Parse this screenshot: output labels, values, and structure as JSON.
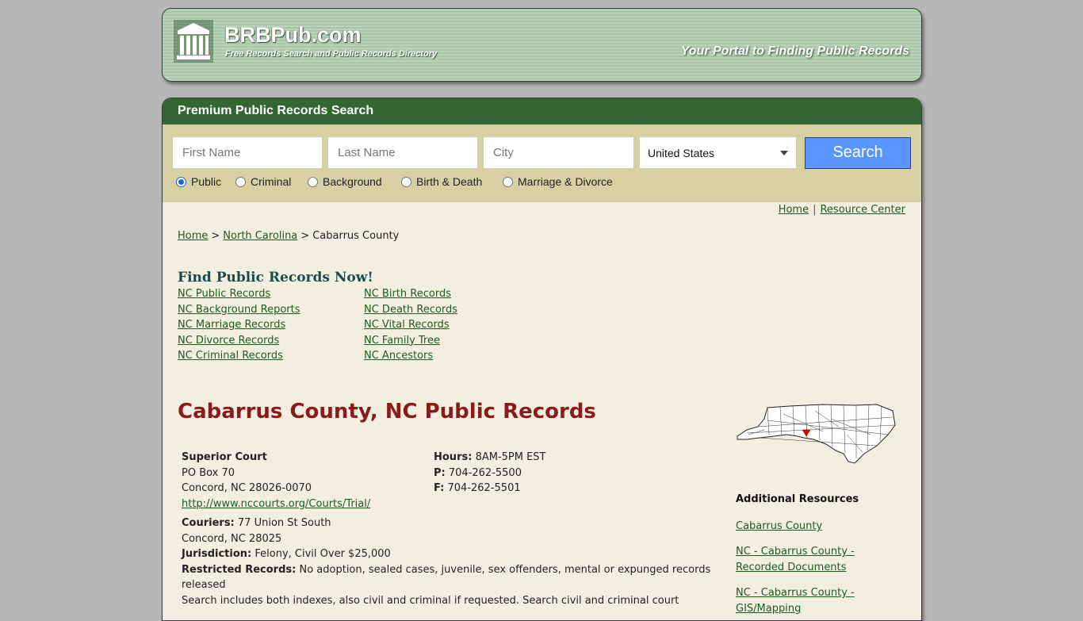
{
  "header": {
    "brand": "BRBPub.com",
    "subtitle": "Free Records Search and Public Records Directory",
    "tagline": "Your Portal to Finding Public Records"
  },
  "search": {
    "heading": "Premium Public Records Search",
    "first_name_placeholder": "First Name",
    "last_name_placeholder": "Last Name",
    "city_placeholder": "City",
    "country_selected": "United States",
    "button_label": "Search",
    "options": [
      {
        "label": "Public",
        "checked": true
      },
      {
        "label": "Criminal",
        "checked": false
      },
      {
        "label": "Background",
        "checked": false
      },
      {
        "label": "Birth & Death",
        "checked": false
      },
      {
        "label": "Marriage & Divorce",
        "checked": false
      }
    ]
  },
  "toplinks": {
    "home": "Home",
    "resource_center": "Resource Center"
  },
  "breadcrumb": {
    "home": "Home",
    "state": "North Carolina",
    "current": "Cabarrus County"
  },
  "find": {
    "title": "Find Public Records Now!",
    "col1": [
      "NC Public Records",
      "NC Background Reports",
      "NC Marriage Records",
      "NC Divorce Records",
      "NC Criminal Records"
    ],
    "col2": [
      "NC Birth Records",
      "NC Death Records",
      "NC Vital Records",
      "NC Family Tree",
      "NC Ancestors"
    ]
  },
  "page_title": "Cabarrus County, NC Public Records",
  "court": {
    "name": "Superior Court",
    "address1": "PO Box 70",
    "address2": "Concord, NC 28026-0070",
    "url": "http://www.nccourts.org/Courts/Trial/",
    "hours_label": "Hours:",
    "hours": "8AM-5PM EST",
    "phone_label": "P:",
    "phone": "704-262-5500",
    "fax_label": "F:",
    "fax": "704-262-5501",
    "couriers_label": "Couriers:",
    "couriers": "77 Union St South",
    "couriers_city": "Concord, NC 28025",
    "jurisdiction_label": "Jurisdiction:",
    "jurisdiction": "Felony, Civil Over $25,000",
    "restricted_label": "Restricted Records:",
    "restricted": "No adoption, sealed cases, juvenile, sex offenders, mental or expunged records released",
    "search_note": "Search includes both indexes, also civil and criminal if requested. Search civil and criminal court"
  },
  "sidebar": {
    "title": "Additional Resources",
    "links": [
      "Cabarrus County",
      "NC - Cabarrus County - Recorded Documents",
      "NC - Cabarrus County - GIS/Mapping"
    ]
  },
  "colors": {
    "header_green": "#336633",
    "search_bg": "#d8d0a2",
    "panel_bg": "#f3efe0",
    "title_red": "#8b1a1a",
    "button_blue": "#5a96ff",
    "link_green": "#1f5a1f"
  }
}
